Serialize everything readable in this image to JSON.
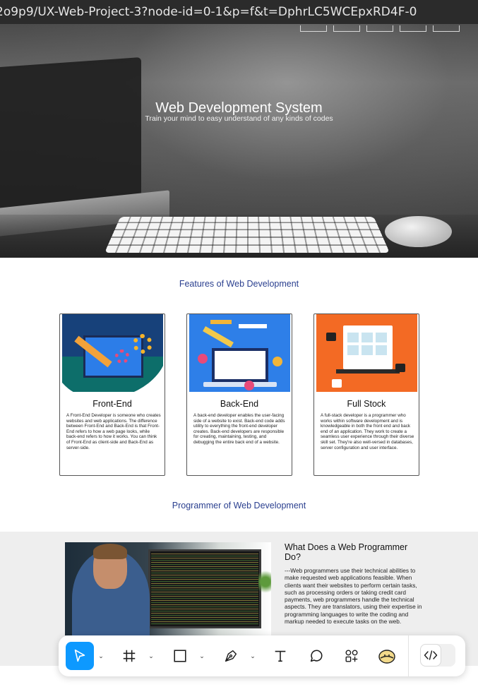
{
  "browser": {
    "url": "2o9p9/UX-Web-Project-3?node-id=0-1&p=f&t=DphrLC5WCEpxRD4F-0"
  },
  "hero": {
    "title": "Web Development System",
    "subtitle": "Train your mind to easy understand of any kinds of codes",
    "nav_box_count": 5
  },
  "features": {
    "heading": "Features of Web Development",
    "cards": [
      {
        "title": "Front-End",
        "body": "A Front-End Developer is someone who creates websites and web applications. The difference between Front-End and Back-End is that Front-End refers to how a web page looks, while back-end refers to how it works. You can think of Front-End as client-side and Back-End as server-side."
      },
      {
        "title": "Back-End",
        "body": "A back-end developer enables the user-facing side of a website to exist. Back-end code adds utility to everything the front-end developer creates. Back-end developers are responsible for creating, maintaining, testing, and debugging the entire back end of a website."
      },
      {
        "title": "Full Stock",
        "body": "A full-stack developer is a programmer who works within software development and is knowledgeable in both the front end and back end of an application. They work to create a seamless user experience through their diverse skill set. They're also well-versed in databases, server configuration and user interface."
      }
    ]
  },
  "programmer": {
    "heading": "Programmer of Web Development",
    "question_title": "What Does a Web Programmer Do?",
    "question_body": "---Web programmers use their technical abilities to make requested web applications feasible. When clients want their websites to perform certain tasks, such as processing orders or taking credit card payments, web programmers handle the technical aspects. They are translators, using their expertise in programming languages to write the coding and markup needed to execute tasks on the web."
  },
  "toolbar": {
    "accent": "#0d99ff",
    "tools": [
      {
        "name": "move-tool",
        "icon": "cursor-arrow-icon",
        "active": true
      },
      {
        "name": "frame-tool",
        "icon": "hash-frame-icon",
        "active": false
      },
      {
        "name": "shape-tool",
        "icon": "rectangle-icon",
        "active": false
      },
      {
        "name": "pen-tool",
        "icon": "pen-nib-icon",
        "active": false
      },
      {
        "name": "text-tool",
        "icon": "text-t-icon",
        "active": false
      },
      {
        "name": "comment-tool",
        "icon": "speech-bubble-icon",
        "active": false
      },
      {
        "name": "components-tool",
        "icon": "shapes-plus-icon",
        "active": false
      },
      {
        "name": "actions-tool",
        "icon": "mascot-avatar-icon",
        "active": false
      }
    ],
    "dev_mode": {
      "icon": "code-brackets-icon",
      "enabled": false
    }
  }
}
